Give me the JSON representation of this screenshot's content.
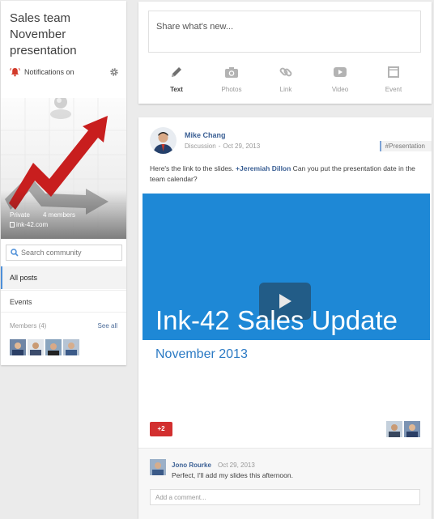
{
  "community": {
    "title_line1": "Sales team",
    "title_line2": "November",
    "title_line3": "presentation",
    "notifications_label": "Notifications on",
    "privacy": "Private",
    "members_count": "4 members",
    "domain": "ink-42.com",
    "search_placeholder": "Search community",
    "nav": {
      "all_posts": "All posts",
      "events": "Events"
    },
    "members_label": "Members (4)",
    "see_all": "See all",
    "icons": [
      "bell-icon",
      "gear-icon",
      "search-icon",
      "building-icon"
    ]
  },
  "share": {
    "placeholder": "Share what's new...",
    "options": [
      {
        "label": "Text",
        "icon": "pencil-icon",
        "active": true
      },
      {
        "label": "Photos",
        "icon": "camera-icon",
        "active": false
      },
      {
        "label": "Link",
        "icon": "link-icon",
        "active": false
      },
      {
        "label": "Video",
        "icon": "video-icon",
        "active": false
      },
      {
        "label": "Event",
        "icon": "calendar-icon",
        "active": false
      }
    ]
  },
  "post": {
    "author": "Mike Chang",
    "category": "Discussion",
    "separator": "-",
    "date": "Oct 29, 2013",
    "tag": "#Presentation",
    "text_before": "Here's the link to the slides. ",
    "mention": "+Jeremiah Dillon",
    "text_after": "  Can you put the presentation date in the team calendar?",
    "slide_title": "Ink-42 Sales Update",
    "slide_date": "November 2013",
    "plus_count": "+2",
    "comment": {
      "author": "Jono Rourke",
      "time": "Oct 29, 2013",
      "text": "Perfect, I'll add my slides this afternoon."
    },
    "add_comment_placeholder": "Add a comment..."
  },
  "colors": {
    "accent_blue": "#1e88d6",
    "plus_red": "#d22f2f",
    "link_blue": "#3a5f94",
    "arrow_red": "#cc2020"
  }
}
